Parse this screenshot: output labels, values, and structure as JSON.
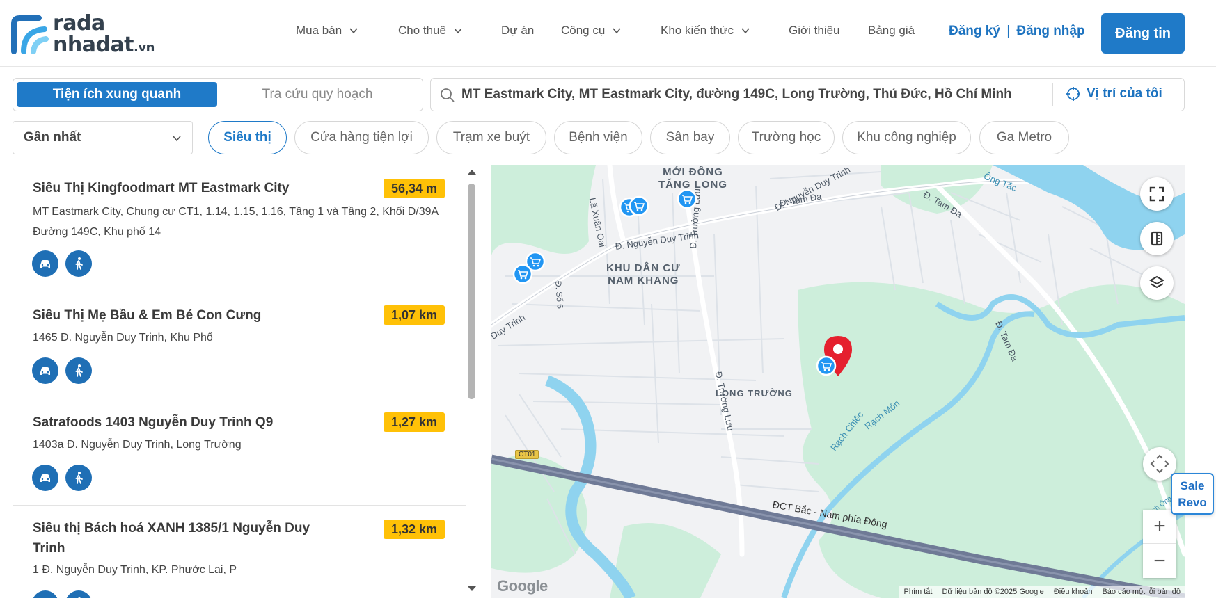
{
  "logo": {
    "line1": "rada",
    "line2": "nhadat",
    "suffix": ".vn"
  },
  "nav": [
    {
      "label": "Mua bán",
      "dropdown": true
    },
    {
      "label": "Cho thuê",
      "dropdown": true
    },
    {
      "label": "Dự án",
      "dropdown": false
    },
    {
      "label": "Công cụ",
      "dropdown": true
    },
    {
      "label": "Kho kiến thức",
      "dropdown": true
    },
    {
      "label": "Giới thiệu",
      "dropdown": false
    },
    {
      "label": "Bảng giá",
      "dropdown": false
    }
  ],
  "auth": {
    "register": "Đăng ký",
    "separator": "|",
    "login": "Đăng nhập"
  },
  "post_button": "Đăng tin",
  "mode_tabs": [
    {
      "label": "Tiện ích xung quanh",
      "active": true
    },
    {
      "label": "Tra cứu quy hoạch",
      "active": false
    }
  ],
  "search": {
    "value": "MT Eastmark City, MT Eastmark City, đường 149C, Long Trường, Thủ Đức, Hồ Chí Minh"
  },
  "locate_button": "Vị trí của tôi",
  "sort": {
    "selected": "Gần nhất"
  },
  "categories": [
    {
      "label": "Siêu thị",
      "active": true
    },
    {
      "label": "Cửa hàng tiện lợi",
      "active": false
    },
    {
      "label": "Trạm xe buýt",
      "active": false
    },
    {
      "label": "Bệnh viện",
      "active": false
    },
    {
      "label": "Sân bay",
      "active": false
    },
    {
      "label": "Trường học",
      "active": false
    },
    {
      "label": "Khu công nghiệp",
      "active": false
    },
    {
      "label": "Ga Metro",
      "active": false
    }
  ],
  "results": [
    {
      "name": "Siêu Thị Kingfoodmart MT Eastmark City",
      "distance": "56,34 m",
      "address": "MT Eastmark City, Chung cư CT1, 1.14, 1.15, 1.16, Tầng 1 và Tầng 2, Khối D/39A Đường 149C, Khu phố 14"
    },
    {
      "name": "Siêu Thị Mẹ Bầu & Em Bé Con Cưng",
      "distance": "1,07 km",
      "address": "1465 Đ. Nguyễn Duy Trinh, Khu Phố"
    },
    {
      "name": "Satrafoods 1403 Nguyễn Duy Trinh Q9",
      "distance": "1,27 km",
      "address": "1403a Đ. Nguyễn Duy Trinh, Long Trường"
    },
    {
      "name": "Siêu thị Bách hoá XANH 1385/1 Nguyễn Duy Trinh",
      "distance": "1,32 km",
      "address": "1 Đ. Nguyễn Duy Trinh, KP. Phước Lai, P"
    }
  ],
  "icons": {
    "drive": "car-icon",
    "walk": "walk-icon"
  },
  "map": {
    "areas": [
      "MỚI ĐÔNG\nTĂNG LONG",
      "KHU DÂN CƯ\nNAM KHANG",
      "LONG TRƯỜNG"
    ],
    "roads": [
      "Lã Xuân Oai",
      "Đ. Nguyễn Duy Trinh",
      "Đ. Nguyễn Duy Trinh",
      "Đ. Tam Đa",
      "Đ. Tam Đa",
      "Đ. Trường Lưu",
      "Đ. Trường Lưu",
      "Đ. Số 6",
      "Đ. Tam Đa",
      "Rạch Chiếc",
      "Rạch Môn",
      "ĐCT Bắc - Nam phía Đông",
      "Ông Tắc",
      "Duy Trinh",
      "CT01",
      "Rạch Ông Thao"
    ],
    "attribution": [
      "Phím tắt",
      "Dữ liệu bản đồ ©2025 Google",
      "Điều khoản",
      "Báo cáo một lỗi bản đồ"
    ],
    "google": "Google",
    "colors": {
      "water": "#8fd3ef",
      "green": "#cdeedb",
      "road": "#ffffff",
      "highway": "#6f7a96",
      "pin": "#e5202e",
      "marker": "#2196f3"
    }
  },
  "sale_badge": {
    "line1": "Sale",
    "line2": "Revo"
  }
}
